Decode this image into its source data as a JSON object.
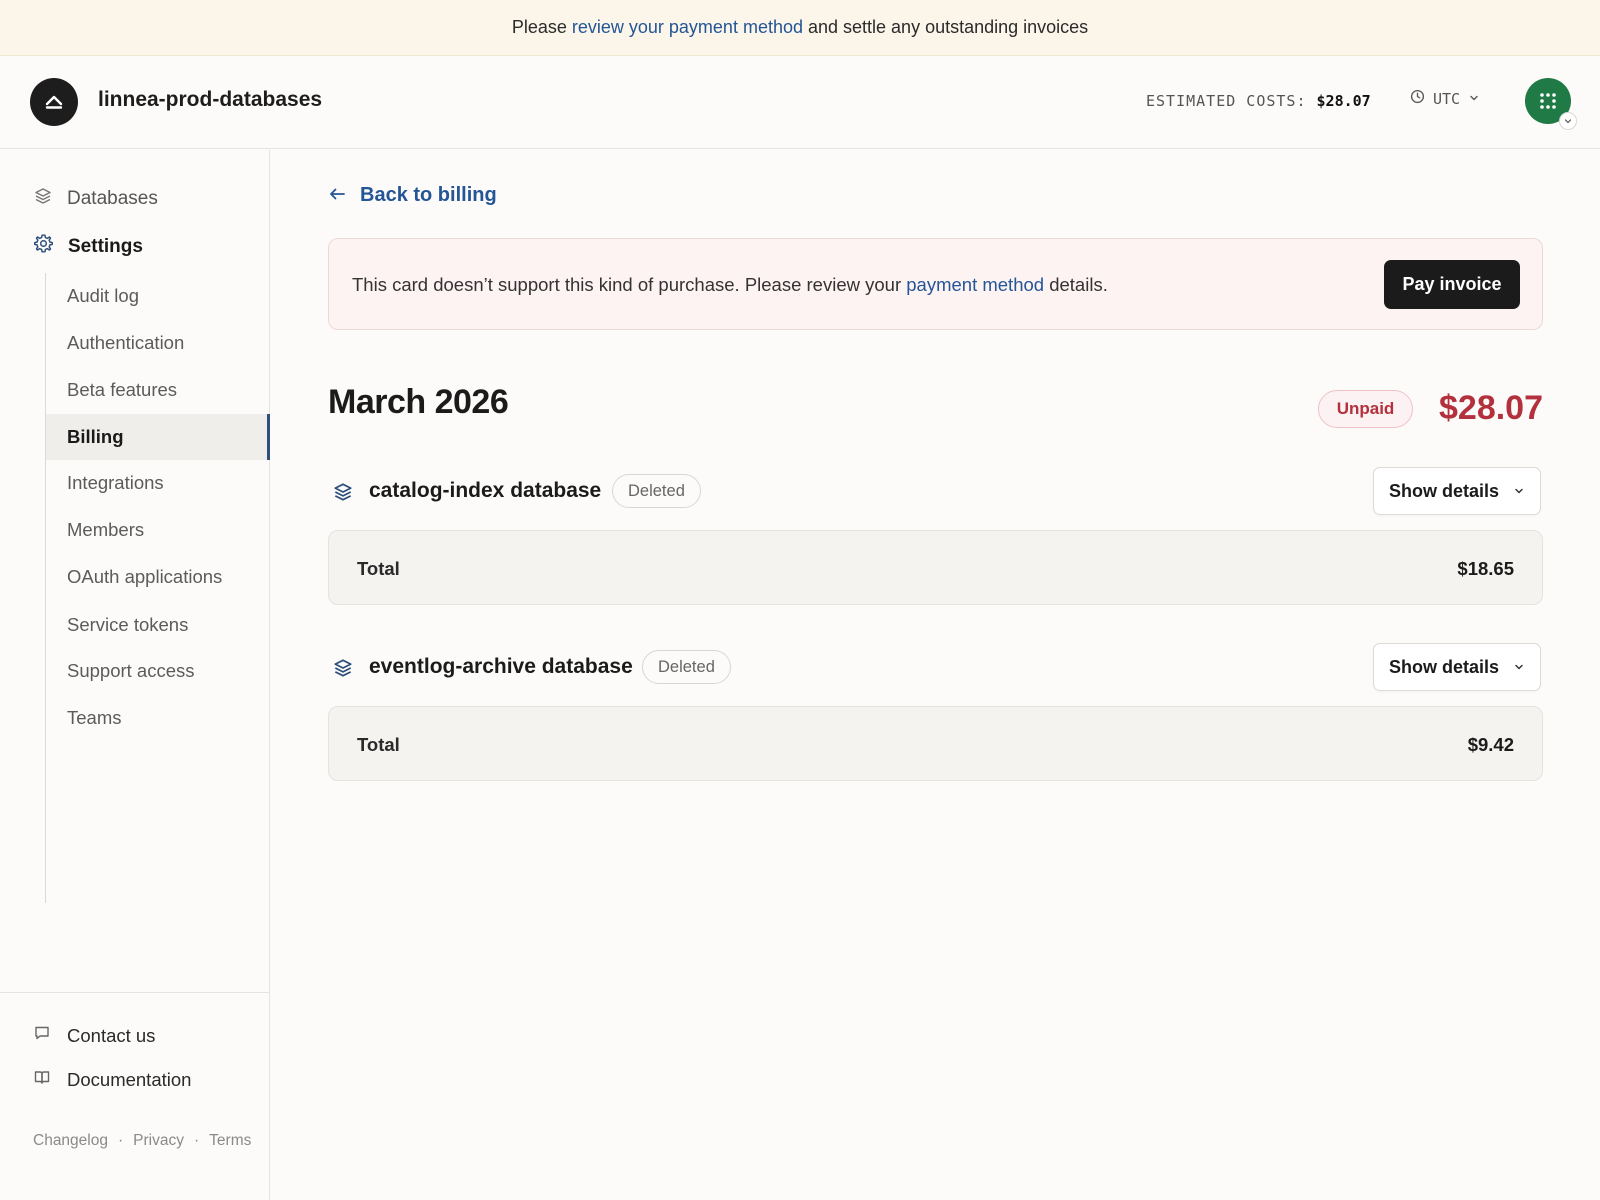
{
  "banner": {
    "prefix": "Please",
    "link": "review your payment method",
    "suffix": "and settle any outstanding invoices"
  },
  "header": {
    "org_name": "linnea-prod-databases",
    "estimated_label": "ESTIMATED COSTS:",
    "estimated_value": "$28.07",
    "timezone": "UTC",
    "avatar_color": "#1f7a45"
  },
  "sidebar": {
    "databases": "Databases",
    "settings": "Settings",
    "items": [
      {
        "label": "Audit log"
      },
      {
        "label": "Authentication"
      },
      {
        "label": "Beta features"
      },
      {
        "label": "Billing",
        "active": true
      },
      {
        "label": "Integrations"
      },
      {
        "label": "Members"
      },
      {
        "label": "OAuth applications"
      },
      {
        "label": "Service tokens"
      },
      {
        "label": "Support access"
      },
      {
        "label": "Teams"
      }
    ],
    "contact": "Contact us",
    "documentation": "Documentation",
    "legal": {
      "changelog": "Changelog",
      "privacy": "Privacy",
      "terms": "Terms",
      "separator": "·"
    }
  },
  "main": {
    "back_label": "Back to billing",
    "alert": {
      "prefix": "This card doesn’t support this kind of purchase. Please review your",
      "link": "payment method",
      "suffix": "details.",
      "button": "Pay invoice"
    },
    "invoice": {
      "month": "March 2026",
      "status": "Unpaid",
      "total": "$28.07",
      "status_color": "#b3313d"
    },
    "databases": [
      {
        "name": "catalog-index database",
        "tag": "Deleted",
        "button": "Show details",
        "total_label": "Total",
        "total": "$18.65"
      },
      {
        "name": "eventlog-archive database",
        "tag": "Deleted",
        "button": "Show details",
        "total_label": "Total",
        "total": "$9.42"
      }
    ]
  }
}
